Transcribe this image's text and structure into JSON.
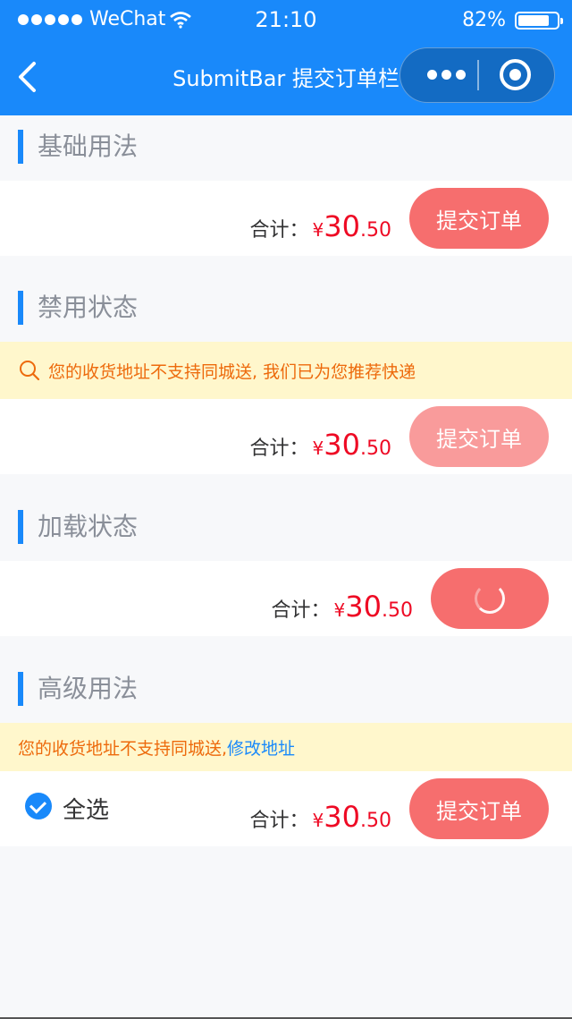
{
  "status": {
    "carrier": "WeChat",
    "time": "21:10",
    "battery": "82%",
    "battery_level": 0.82
  },
  "nav": {
    "title": "SubmitBar 提交订单栏"
  },
  "sections": [
    {
      "title": "基础用法",
      "total_label": "合计：",
      "currency": "¥",
      "price_int": "30",
      "price_dec": ".50",
      "button": "提交订单"
    },
    {
      "title": "禁用状态",
      "notice": "您的收货地址不支持同城送, 我们已为您推荐快递",
      "total_label": "合计：",
      "currency": "¥",
      "price_int": "30",
      "price_dec": ".50",
      "button": "提交订单"
    },
    {
      "title": "加载状态",
      "total_label": "合计：",
      "currency": "¥",
      "price_int": "30",
      "price_dec": ".50"
    },
    {
      "title": "高级用法",
      "notice": "您的收货地址不支持同城送, ",
      "notice_link": "修改地址",
      "checkbox_label": "全选",
      "total_label": "合计：",
      "currency": "¥",
      "price_int": "30",
      "price_dec": ".50",
      "button": "提交订单"
    }
  ],
  "colors": {
    "primary": "#1989fa",
    "price": "#ee0a24",
    "button": "#f66e6e",
    "button_disabled": "#f99b9b",
    "notice_bg": "#fff7cc",
    "notice_text": "#ed6a0c"
  }
}
